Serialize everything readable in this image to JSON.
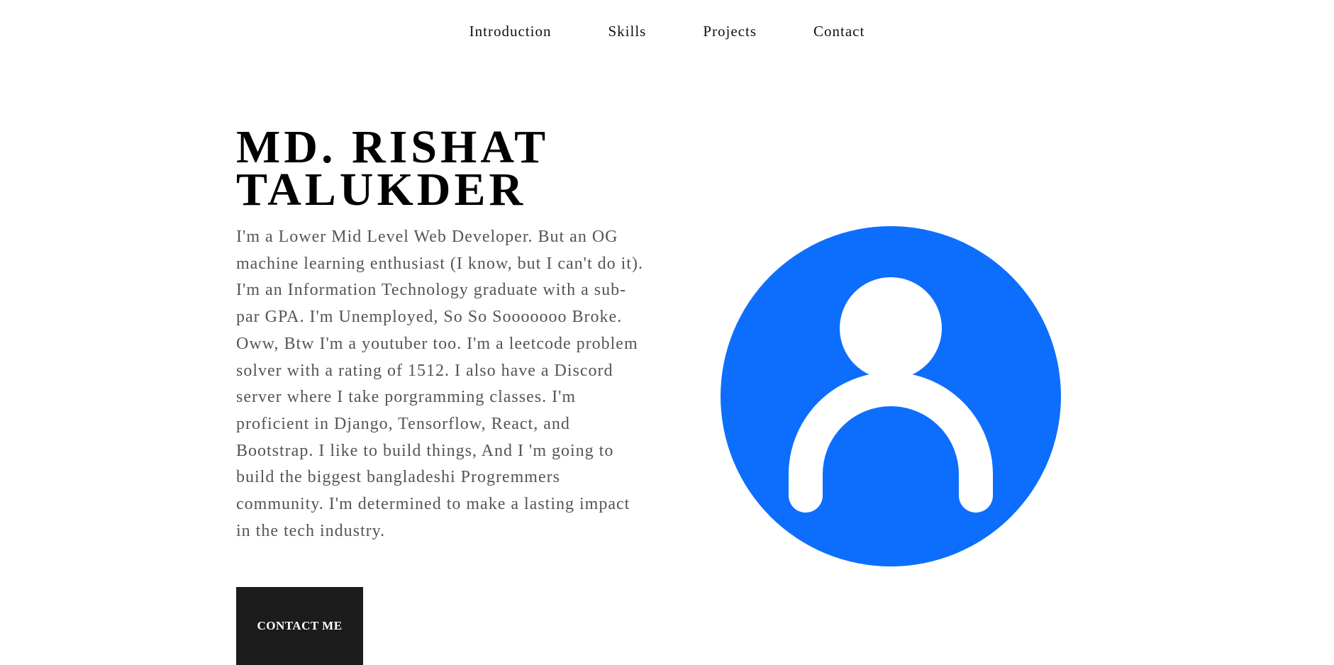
{
  "nav": {
    "items": [
      {
        "label": "Introduction"
      },
      {
        "label": "Skills"
      },
      {
        "label": "Projects"
      },
      {
        "label": "Contact"
      }
    ]
  },
  "hero": {
    "title": "MD. RISHAT TALUKDER",
    "bio": "I'm a Lower Mid Level Web Developer. But an OG machine learning enthusiast (I know, but I can't do it). I'm an Information Technology graduate with a sub-par GPA. I'm Unemployed, So So Sooooooo Broke. Oww, Btw I'm a youtuber too. I'm a leetcode problem solver with a rating of 1512. I also have a Discord server where I take porgramming classes. I'm proficient in Django, Tensorflow, React, and Bootstrap. I like to build things, And I 'm going to build the biggest bangladeshi Progremmers community. I'm determined to make a lasting impact in the tech industry.",
    "contact_label": "CONTACT ME"
  },
  "avatar": {
    "icon": "user-avatar-icon",
    "color": "#0d6efd"
  }
}
